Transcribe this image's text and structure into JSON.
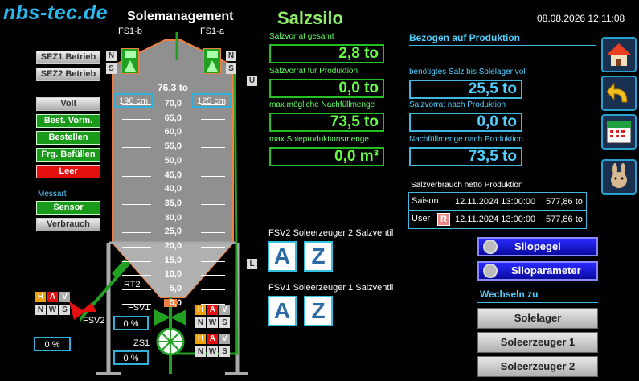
{
  "header": {
    "logo": "nbs-tec.de",
    "title_left": "Solemanagement",
    "title_center": "Salzsilo",
    "datetime": "08.08.2026 12:11:08"
  },
  "left_panel": {
    "sez1": "SEZ1 Betrieb",
    "sez2": "SEZ2 Betrieb",
    "voll": "Voll",
    "best_vorm": "Best. Vorm.",
    "bestellen": "Bestellen",
    "frg_befuellen": "Frg. Befüllen",
    "leer": "Leer",
    "messart_label": "Messart",
    "sensor": "Sensor",
    "verbrauch": "Verbrauch"
  },
  "silo": {
    "fs1b_label": "FS1-b",
    "fs1a_label": "FS1-a",
    "left_distance": "196 cm",
    "right_distance": "125 cm",
    "top_value": "76,3 to",
    "scale": [
      "70,0",
      "65,0",
      "60,0",
      "55,0",
      "50,0",
      "45,0",
      "40,0",
      "35,0",
      "30,0",
      "25,0",
      "20,0",
      "15,0",
      "10,0",
      "5,0",
      "0,0"
    ],
    "u_label": "U",
    "l_label": "L",
    "rt2_label": "RT2",
    "fsv1_label": "FSV1",
    "fsv1_value": "0 %",
    "zs1_label": "ZS1",
    "zs1_value": "0 %",
    "fsv2_label": "FSV2",
    "fsv2_value": "0 %",
    "n": "N",
    "s": "S",
    "h": "H",
    "a": "A",
    "v": "V",
    "w": "W",
    "fill_fraction": 0.27
  },
  "center_panel": {
    "salzvorrat_gesamt_label": "Salzvorrat gesamt",
    "salzvorrat_gesamt": "2,8 to",
    "salzvorrat_prod_label": "Salzvorrat für Produktion",
    "salzvorrat_prod": "0,0 to",
    "max_nachfuell_label": "max mögliche Nachfüllmenge",
    "max_nachfuell": "73,5 to",
    "max_sole_label": "max Soleproduktionsmenge",
    "max_sole": "0,0 m³",
    "fsv2_label": "FSV2 Soleerzeuger 2 Salzventil",
    "fsv1_label": "FSV1 Soleerzeuger 1 Salzventil",
    "a": "A",
    "z": "Z"
  },
  "right_panel": {
    "heading": "Bezogen auf Produktion",
    "salz_bis_voll_label": "benötigtes Salz bis Solelager voll",
    "salz_bis_voll": "25,5 to",
    "vorrat_nach_label": "Salzvorrat nach Produktion",
    "vorrat_nach": "0,0 to",
    "nachfuell_nach_label": "Nachfüllmenge nach Produktion",
    "nachfuell_nach": "73,5 to",
    "verbrauch_label": "Salzverbrauch netto Produktion",
    "saison_label": "Saison",
    "saison_date": "12.11.2024 13:00:00",
    "saison_value": "577,86 to",
    "user_label": "User",
    "reset_label": "R",
    "user_date": "12.11.2024 13:00:00",
    "user_value": "577,86 to",
    "silopegel": "Silopegel",
    "siloparameter": "Siloparameter",
    "wechseln_label": "Wechseln zu",
    "solelager": "Solelager",
    "soleerzeuger1": "Soleerzeuger 1",
    "soleerzeuger2": "Soleerzeuger 2"
  },
  "colors": {
    "accent_green": "#66ff44",
    "accent_cyan": "#50d0ff",
    "silo_orange": "#f08040",
    "pipe_green": "#22a022"
  }
}
